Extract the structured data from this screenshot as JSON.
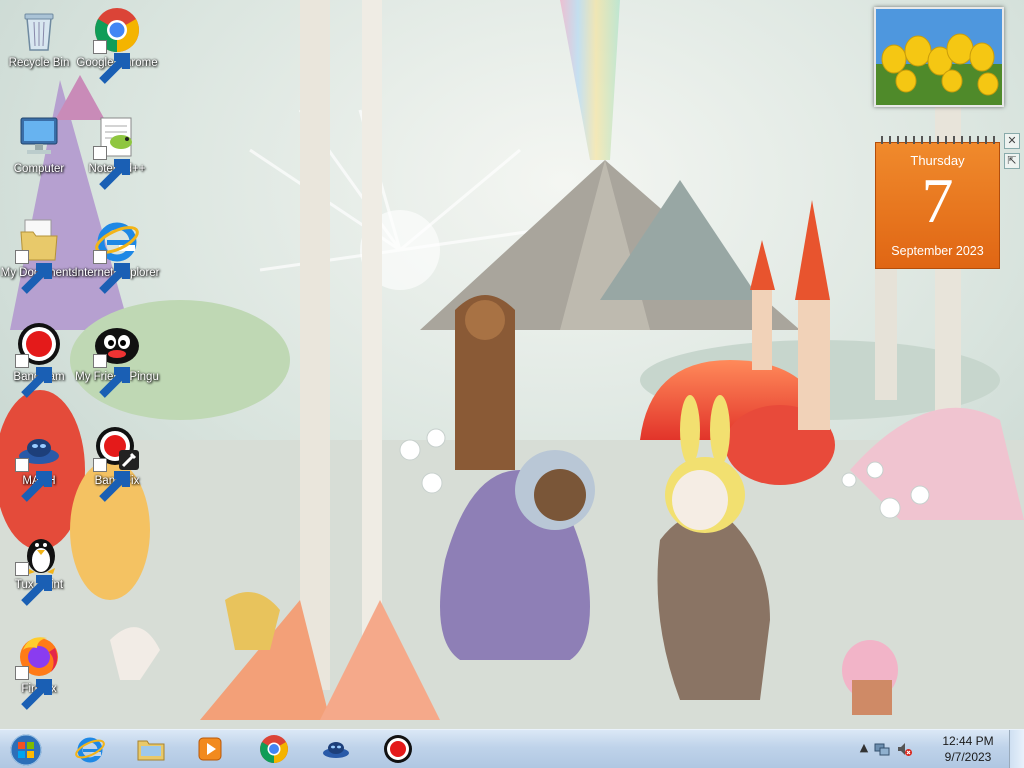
{
  "desktop": {
    "icons": [
      {
        "label": "Recycle Bin",
        "icon": "recycle-bin-icon"
      },
      {
        "label": "Google Chrome",
        "icon": "chrome-icon"
      },
      {
        "label": "Computer",
        "icon": "computer-icon"
      },
      {
        "label": "Notepad++",
        "icon": "notepad-plus-plus-icon"
      },
      {
        "label": "My Documents",
        "icon": "folder-icon"
      },
      {
        "label": "Internet Explorer",
        "icon": "internet-explorer-icon"
      },
      {
        "label": "Bandicam",
        "icon": "bandicam-icon"
      },
      {
        "label": "My Friend Pingu",
        "icon": "pingu-icon"
      },
      {
        "label": "MASH",
        "icon": "mash-icon"
      },
      {
        "label": "BandiFix",
        "icon": "bandifix-icon"
      },
      {
        "label": "Tux Paint",
        "icon": "tux-paint-icon"
      },
      {
        "label": "Firefox",
        "icon": "firefox-icon"
      }
    ]
  },
  "gadgets": {
    "calendar": {
      "weekday": "Thursday",
      "day": "7",
      "month_year": "September 2023"
    },
    "close_symbol": "✕",
    "expand_symbol": "⇱"
  },
  "taskbar": {
    "start_icon": "windows-start-orb-icon",
    "pinned": [
      {
        "name": "internet-explorer"
      },
      {
        "name": "windows-explorer"
      },
      {
        "name": "windows-media-player"
      },
      {
        "name": "google-chrome"
      },
      {
        "name": "mash"
      },
      {
        "name": "bandicam"
      }
    ],
    "tray": {
      "time": "12:44 PM",
      "date": "9/7/2023",
      "arrow": "▲"
    }
  },
  "colors": {
    "calendar_orange": "#e8741c",
    "taskbar": "#c4d7ec"
  }
}
